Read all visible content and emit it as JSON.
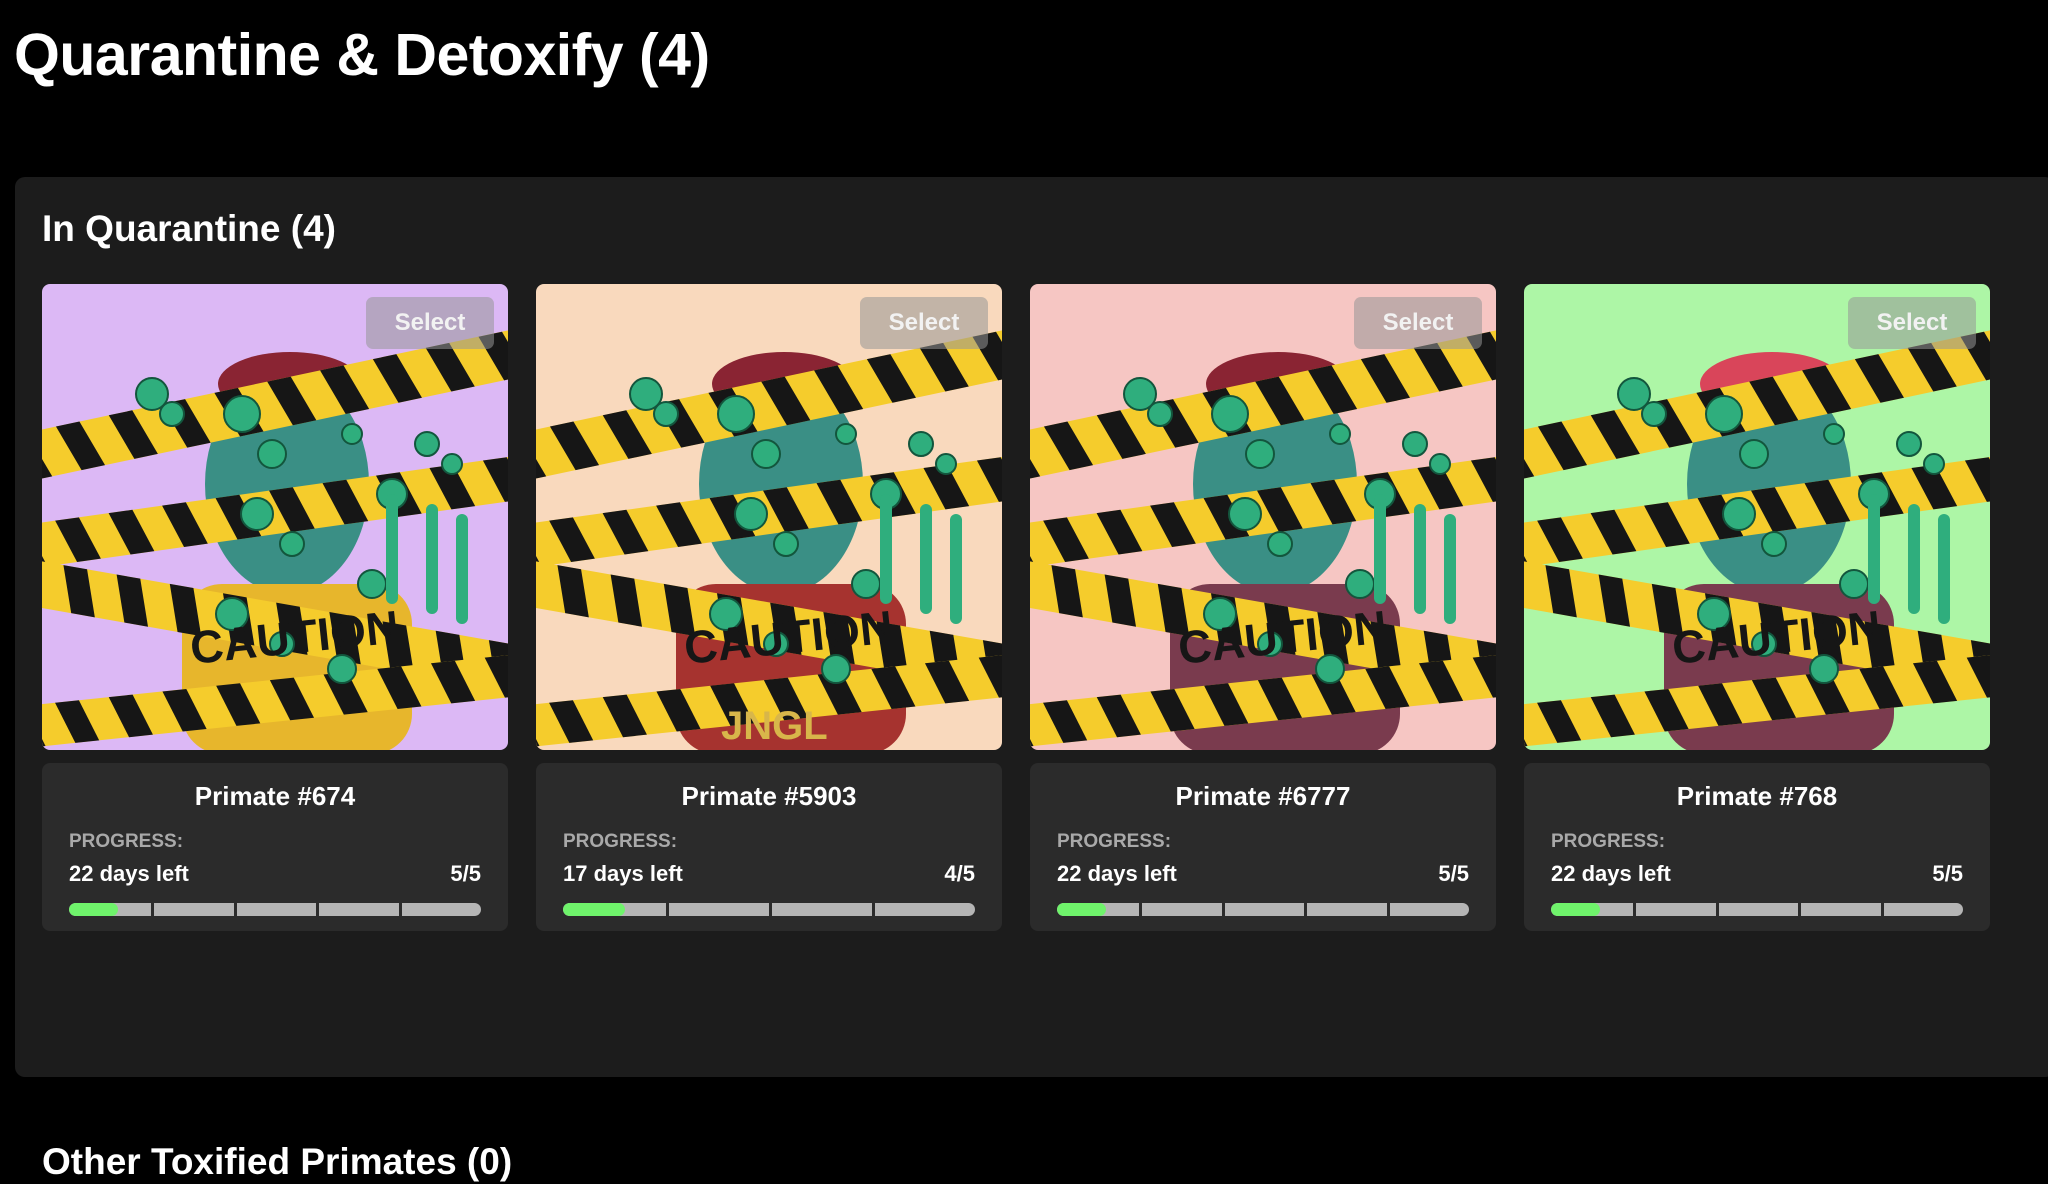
{
  "page": {
    "title": "Quarantine & Detoxify (4)"
  },
  "sections": {
    "quarantine_title": "In Quarantine (4)",
    "other_title": "Other Toxified Primates (0)"
  },
  "progress_label": "PROGRESS:",
  "cards": [
    {
      "name": "Primate #674",
      "select_label": "Select",
      "days_left": "22 days left",
      "count": "5/5",
      "segments": 5,
      "fill_fraction": 0.12,
      "bg_color": "#dcb8f5"
    },
    {
      "name": "Primate #5903",
      "select_label": "Select",
      "days_left": "17 days left",
      "count": "4/5",
      "segments": 4,
      "fill_fraction": 0.15,
      "bg_color": "#f9d9bd",
      "shirt_text": "JNGL"
    },
    {
      "name": "Primate #6777",
      "select_label": "Select",
      "days_left": "22 days left",
      "count": "5/5",
      "segments": 5,
      "fill_fraction": 0.12,
      "bg_color": "#f6c6c3"
    },
    {
      "name": "Primate #768",
      "select_label": "Select",
      "days_left": "22 days left",
      "count": "5/5",
      "segments": 5,
      "fill_fraction": 0.12,
      "bg_color": "#adf6a6"
    }
  ],
  "colors": {
    "tape_yellow": "#f5cc2c",
    "tape_black": "#161616",
    "slime_green": "#2fae7d",
    "progress_green": "#6ff36b",
    "progress_track": "#b5b5b5"
  },
  "tape_text": "CAUTION"
}
